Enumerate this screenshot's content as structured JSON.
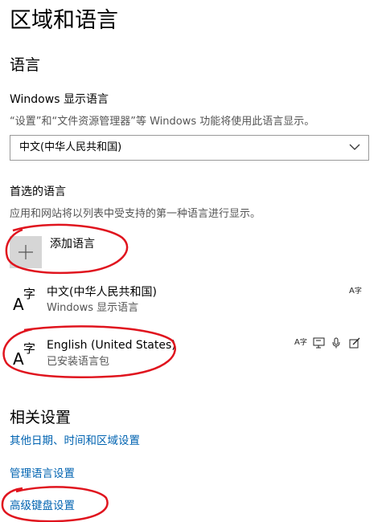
{
  "page": {
    "title": "区域和语言"
  },
  "language_section": {
    "title": "语言",
    "display_language": {
      "label": "Windows 显示语言",
      "description": "“设置”和“文件资源管理器”等 Windows 功能将使用此语言显示。",
      "selected": "中文(中华人民共和国)"
    }
  },
  "preferred": {
    "title": "首选的语言",
    "description": "应用和网站将以列表中受支持的第一种语言进行显示。",
    "add_label": "添加语言",
    "languages": [
      {
        "icon_char": "字",
        "icon_a": "A",
        "name": "中文(中华人民共和国)",
        "status": "Windows 显示语言",
        "feature_icons": [
          "display-language-icon"
        ]
      },
      {
        "icon_char": "字",
        "icon_a": "A",
        "name": "English (United States)",
        "status": "已安装语言包",
        "feature_icons": [
          "display-language-icon",
          "text-to-speech-icon",
          "speech-recognition-icon",
          "handwriting-icon"
        ]
      }
    ]
  },
  "related": {
    "title": "相关设置",
    "links": [
      "其他日期、时间和区域设置",
      "管理语言设置",
      "高级键盘设置"
    ]
  },
  "colors": {
    "link": "#0063b1",
    "annotation": "#e0141e",
    "tile": "#d6d6d6"
  }
}
